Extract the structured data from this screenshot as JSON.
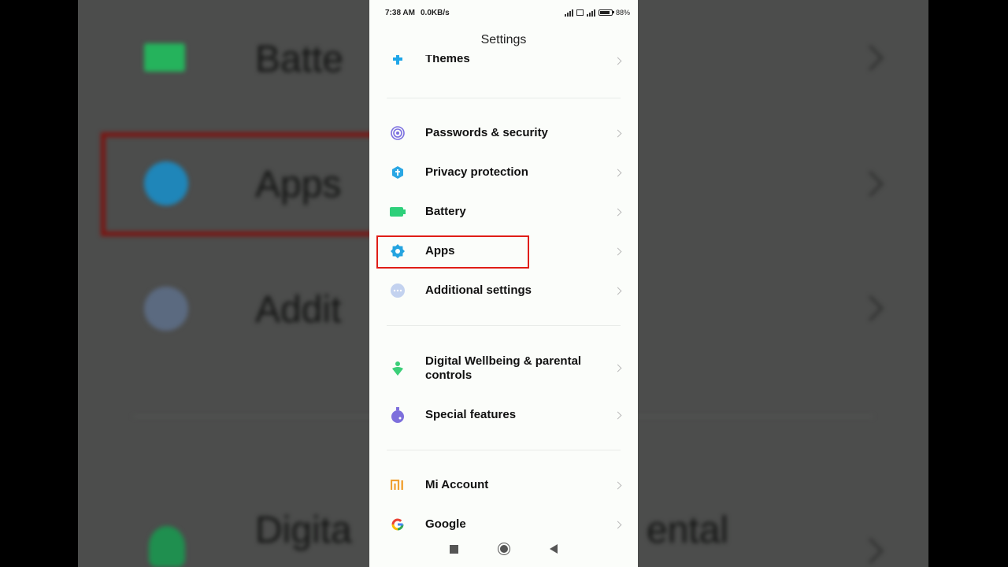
{
  "status": {
    "time": "7:38 AM",
    "speed": "0.0KB/s",
    "battery": "88%"
  },
  "header": {
    "title": "Settings"
  },
  "items": [
    {
      "label": "Themes",
      "icon": "themes-icon",
      "color": "#1ea6e8"
    },
    {
      "label": "Passwords & security",
      "icon": "fingerprint-icon",
      "color": "#7b6fe0"
    },
    {
      "label": "Privacy protection",
      "icon": "privacy-shield-icon",
      "color": "#2aa7e4"
    },
    {
      "label": "Battery",
      "icon": "battery-icon",
      "color": "#2ed07a"
    },
    {
      "label": "Apps",
      "icon": "gear-icon",
      "color": "#25a4e0"
    },
    {
      "label": "Additional settings",
      "icon": "more-dots-icon",
      "color": "#9fb6e6"
    },
    {
      "label": "Digital Wellbeing & parental controls",
      "icon": "wellbeing-icon",
      "color": "#3bcf78"
    },
    {
      "label": "Special features",
      "icon": "special-features-icon",
      "color": "#7d6fdc"
    },
    {
      "label": "Mi Account",
      "icon": "mi-account-icon",
      "color": "#f0a030"
    },
    {
      "label": "Google",
      "icon": "google-icon",
      "color": "#4285f4"
    }
  ],
  "background": {
    "labels": [
      "Batte",
      "Apps",
      "Addit",
      "Digita",
      "ental"
    ]
  }
}
